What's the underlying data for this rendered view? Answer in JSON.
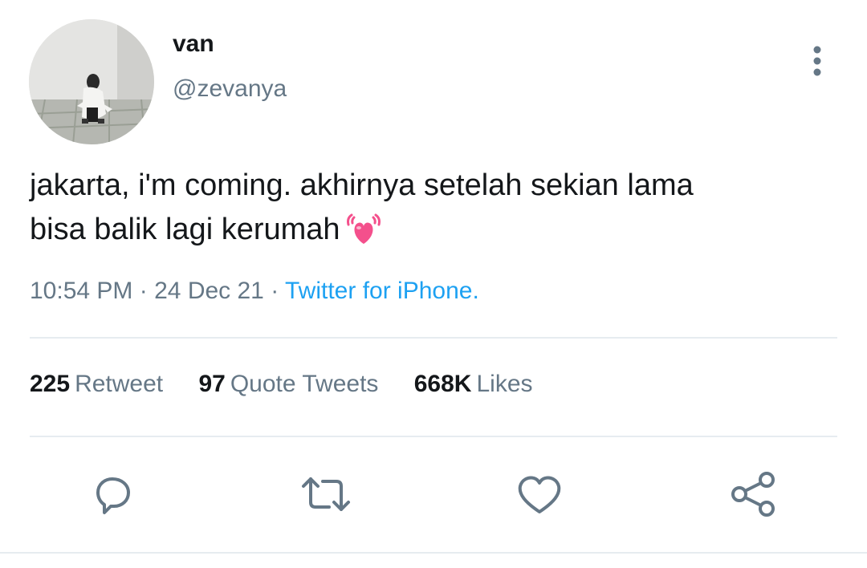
{
  "tweet": {
    "display_name": "van",
    "handle": "@zevanya",
    "text_line1": "jakarta, i'm coming. akhirnya setelah sekian lama",
    "text_line2": "bisa balik lagi kerumah",
    "emoji": "growing-heart-emoji",
    "time": "10:54 PM",
    "separator": "·",
    "date": "24 Dec 21",
    "source": "Twitter for iPhone."
  },
  "stats": [
    {
      "count": "225",
      "label": "Retweet"
    },
    {
      "count": "97",
      "label": "Quote Tweets"
    },
    {
      "count": "668K",
      "label": "Likes"
    }
  ],
  "colors": {
    "primary_text": "#14171a",
    "secondary_text": "#657786",
    "link": "#1da1f2",
    "divider": "#e6ecf0",
    "emoji_pink": "#f4508c"
  },
  "icons": {
    "more": "more-vertical-icon",
    "reply": "reply-icon",
    "retweet": "retweet-icon",
    "like": "heart-icon",
    "share": "share-icon"
  }
}
